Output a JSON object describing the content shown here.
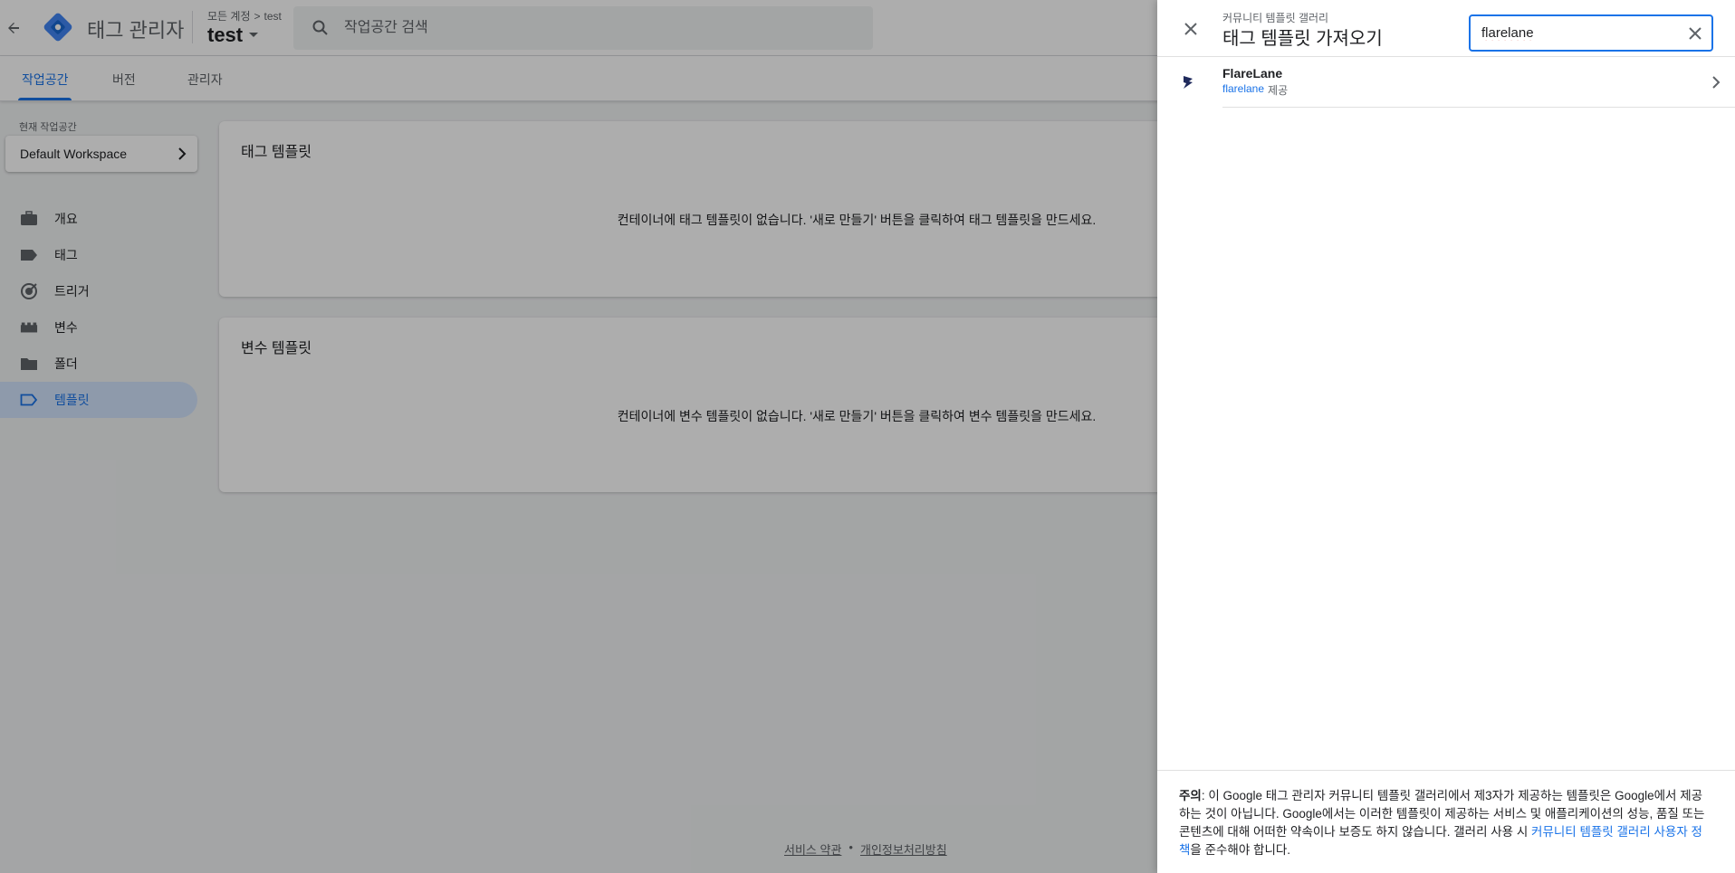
{
  "app": {
    "title": "태그 관리자",
    "breadcrumb_root": "모든 계정",
    "breadcrumb_sep": ">",
    "breadcrumb_account": "test",
    "container_name": "test",
    "search_placeholder": "작업공간 검색"
  },
  "tabs": [
    {
      "label": "작업공간",
      "active": true
    },
    {
      "label": "버전",
      "active": false
    },
    {
      "label": "관리자",
      "active": false
    }
  ],
  "sidebar": {
    "workspace_label": "현재 작업공간",
    "workspace_name": "Default Workspace",
    "items": [
      {
        "label": "개요",
        "icon": "briefcase-icon"
      },
      {
        "label": "태그",
        "icon": "tag-icon"
      },
      {
        "label": "트리거",
        "icon": "trigger-icon"
      },
      {
        "label": "변수",
        "icon": "variables-icon"
      },
      {
        "label": "폴더",
        "icon": "folder-icon"
      },
      {
        "label": "템플릿",
        "icon": "template-icon",
        "active": true
      }
    ]
  },
  "main": {
    "tag_templates": {
      "title": "태그 템플릿",
      "empty": "컨테이너에 태그 템플릿이 없습니다. '새로 만들기' 버튼을 클릭하여 태그 템플릿을 만드세요."
    },
    "var_templates": {
      "title": "변수 템플릿",
      "empty": "컨테이너에 변수 템플릿이 없습니다. '새로 만들기' 버튼을 클릭하여 변수 템플릿을 만드세요."
    }
  },
  "footer": {
    "terms": "서비스 약관",
    "dot": "•",
    "privacy": "개인정보처리방침"
  },
  "panel": {
    "subtitle": "커뮤니티 템플릿 갤러리",
    "title": "태그 템플릿 가져오기",
    "search_value": "flarelane",
    "results": [
      {
        "name": "FlareLane",
        "publisher": "flarelane",
        "publisher_suffix": "제공"
      }
    ],
    "notice": {
      "label": "주의",
      "text": ": 이 Google 태그 관리자 커뮤니티 템플릿 갤러리에서 제3자가 제공하는 템플릿은 Google에서 제공하는 것이 아닙니다. Google에서는 이러한 템플릿이 제공하는 서비스 및 애플리케이션의 성능, 품질 또는 콘텐츠에 대해 어떠한 약속이나 보증도 하지 않습니다. 갤러리 사용 시 ",
      "link": "커뮤니티 템플릿 갤러리 사용자 정책",
      "tail": "을 준수해야 합니다."
    }
  },
  "colors": {
    "accent": "#1a73e8",
    "nav_active_bg": "#d2e3fc",
    "logo_blue": "#4285f4",
    "logo_dark": "#1967d2"
  }
}
